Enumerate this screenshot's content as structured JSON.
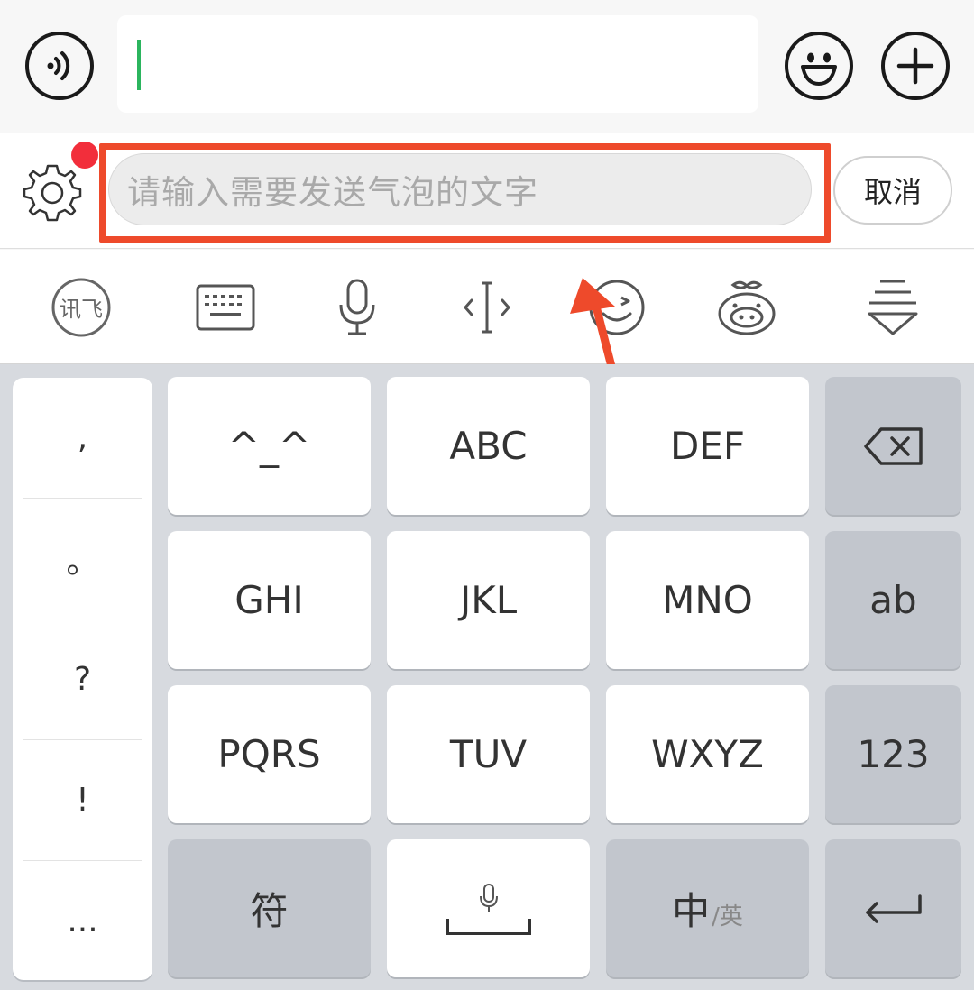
{
  "chat_bar": {
    "input_value": ""
  },
  "bubble_bar": {
    "placeholder": "请输入需要发送气泡的文字",
    "cancel_label": "取消"
  },
  "toolbar": {
    "icons": [
      "xunfei-logo-icon",
      "keyboard-icon",
      "microphone-icon",
      "cursor-move-icon",
      "emoji-face-icon",
      "mascot-icon",
      "collapse-keyboard-icon"
    ],
    "xunfei_label": "讯飞"
  },
  "keyboard": {
    "punctuation": [
      ",",
      "。",
      "?",
      "!",
      "..."
    ],
    "keys": {
      "k1": "^_^",
      "k2": "ABC",
      "k3": "DEF",
      "k4": "GHI",
      "k5": "JKL",
      "k6": "MNO",
      "k7": "PQRS",
      "k8": "TUV",
      "k9": "WXYZ",
      "ab": "ab",
      "num": "123",
      "symbol": "符",
      "lang_main": "中",
      "lang_sub": "/英"
    }
  },
  "colors": {
    "highlight": "#ee4a2b",
    "caret": "#2bb55e",
    "notification_dot": "#f22e3b",
    "keyboard_bg": "#d7dadf",
    "function_key": "#c2c6cd"
  }
}
